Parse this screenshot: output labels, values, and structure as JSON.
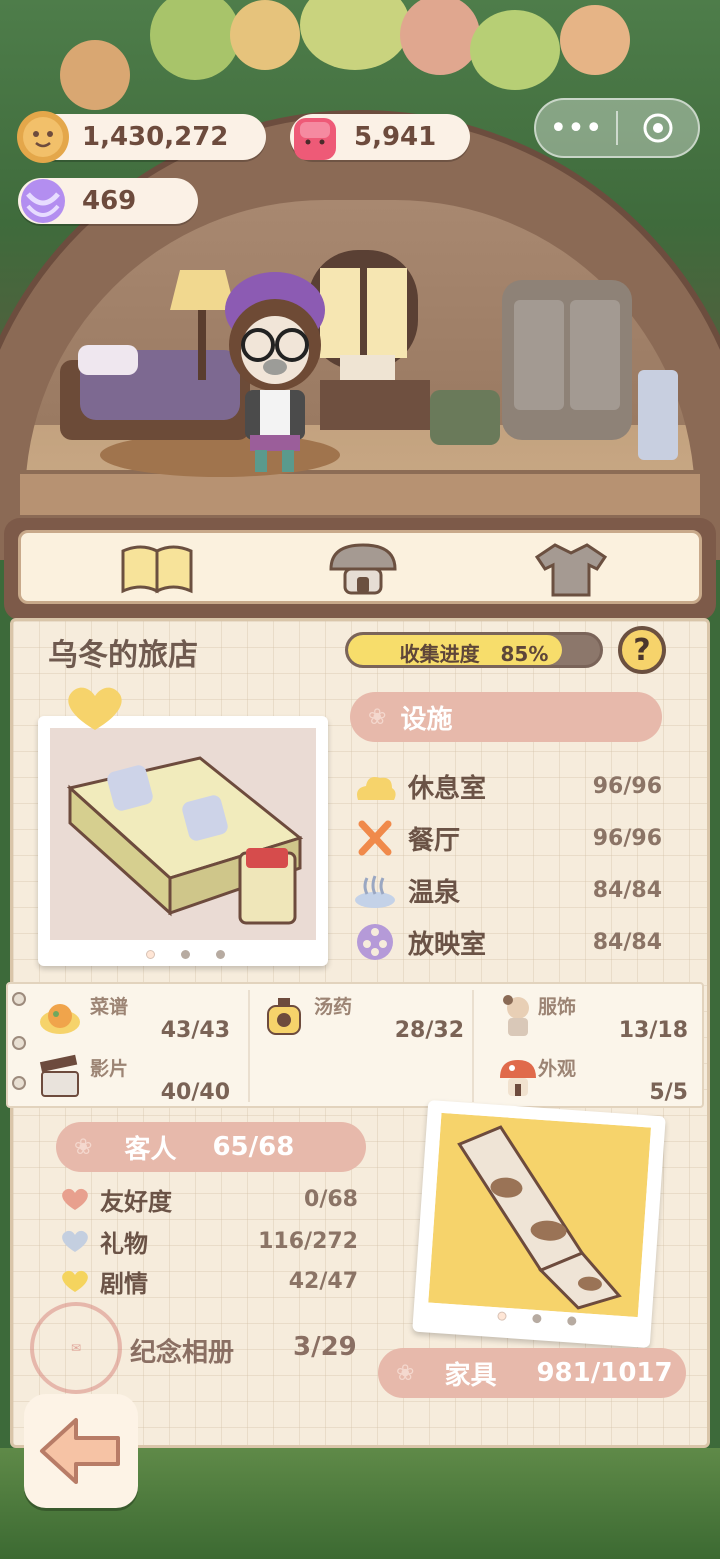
{
  "resources": {
    "coins": "1,430,272",
    "gems": "5,941",
    "candy": "469"
  },
  "miniprogram": {
    "more_icon": "more-dots-icon",
    "close_icon": "target-circle-icon"
  },
  "tabs": [
    {
      "name": "book",
      "icon": "open-book-icon",
      "active": true
    },
    {
      "name": "hotel",
      "icon": "mushroom-hotel-icon",
      "active": false
    },
    {
      "name": "outfit",
      "icon": "shirt-icon",
      "active": false
    }
  ],
  "inn": {
    "title": "乌冬的旅店",
    "collect_label": "收集进度",
    "collect_percent": "85%",
    "collect_fraction": 0.85,
    "help": "?"
  },
  "facilities": {
    "label": "设施",
    "items": [
      {
        "name": "休息室",
        "value": "96/96",
        "icon": "cloud-icon"
      },
      {
        "name": "餐厅",
        "value": "96/96",
        "icon": "fork-knife-icon"
      },
      {
        "name": "温泉",
        "value": "84/84",
        "icon": "hot-spring-icon"
      },
      {
        "name": "放映室",
        "value": "84/84",
        "icon": "film-reel-icon"
      }
    ]
  },
  "categories": [
    {
      "name": "菜谱",
      "value": "43/43",
      "icon": "dish-icon"
    },
    {
      "name": "汤药",
      "value": "28/32",
      "icon": "potion-pot-icon"
    },
    {
      "name": "服饰",
      "value": "13/18",
      "icon": "doll-icon"
    },
    {
      "name": "影片",
      "value": "40/40",
      "icon": "clapperboard-icon"
    },
    {
      "name": "外观",
      "value": "5/5",
      "icon": "mushroom-house-icon"
    }
  ],
  "guests": {
    "label": "客人",
    "value": "65/68",
    "items": [
      {
        "name": "友好度",
        "value": "0/68",
        "icon": "heart-icon",
        "color": "#e8a08e"
      },
      {
        "name": "礼物",
        "value": "116/272",
        "icon": "gift-icon",
        "color": "#c4cfe0"
      },
      {
        "name": "剧情",
        "value": "42/47",
        "icon": "story-heart-icon",
        "color": "#f5d45e"
      }
    ]
  },
  "album": {
    "label": "纪念相册",
    "value": "3/29"
  },
  "furniture": {
    "label": "家具",
    "value": "981/1017"
  },
  "back_icon": "arrow-left-icon",
  "colors": {
    "pill": "#e7b9ab",
    "progress": "#f7dd6b",
    "frame": "#7d5a49"
  }
}
